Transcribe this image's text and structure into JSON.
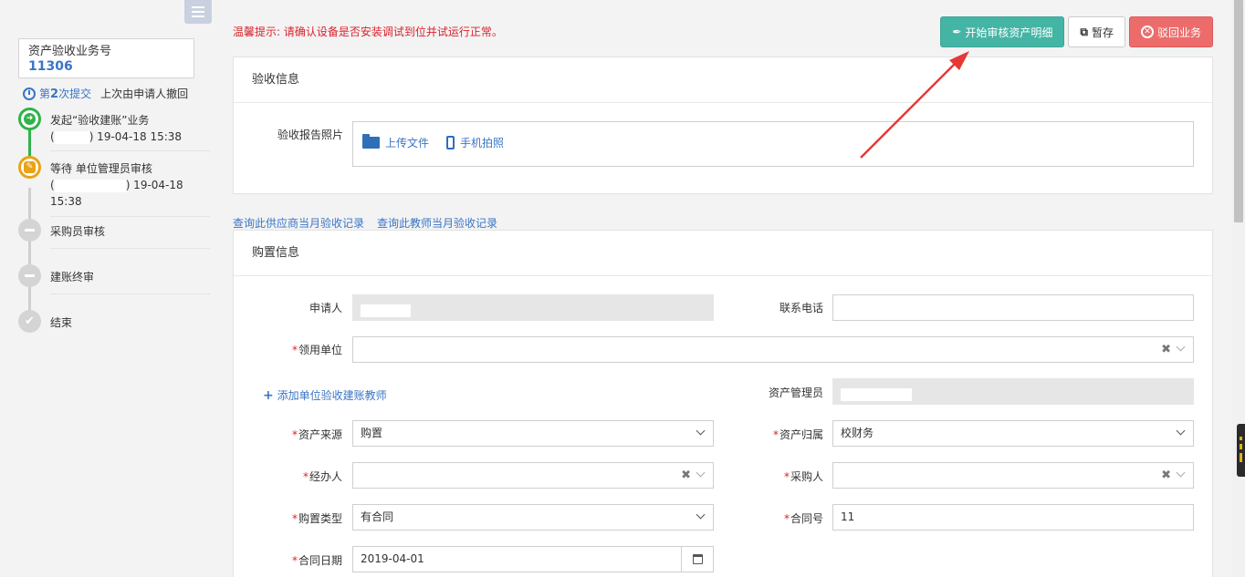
{
  "sidebar": {
    "biz_label": "资产验收业务号",
    "biz_number": "11306",
    "submit_prefix": "第",
    "submit_count": "2",
    "submit_suffix": "次提交",
    "submit_note": "上次由申请人撤回",
    "steps": [
      {
        "line1": "发起“验收建账”业务",
        "line2_prefix": "(",
        "line2_suffix": ") 19-04-18 15:38"
      },
      {
        "line1": "等待 单位管理员审核",
        "line2_prefix": "(",
        "line2_suffix": ") 19-04-18",
        "line3": "15:38"
      },
      {
        "line1": "采购员审核"
      },
      {
        "line1": "建账终审"
      },
      {
        "line1": "结束"
      }
    ]
  },
  "header": {
    "tip": "温馨提示: 请确认设备是否安装调试到位并试运行正常。",
    "btn_start_review": "开始审核资产明细",
    "btn_save": "暂存",
    "btn_withdraw": "驳回业务"
  },
  "acceptance": {
    "title": "验收信息",
    "photo_label": "验收报告照片",
    "upload_file": "上传文件",
    "phone_photo": "手机拍照"
  },
  "links": {
    "supplier_records": "查询此供应商当月验收记录",
    "teacher_records": "查询此教师当月验收记录"
  },
  "purchase": {
    "title": "购置信息",
    "applicant_label": "申请人",
    "phone_label": "联系电话",
    "unit_label": "领用单位",
    "add_teacher": "添加单位验收建账教师",
    "asset_manager_label": "资产管理员",
    "source_label": "资产来源",
    "source_value": "购置",
    "ownership_label": "资产归属",
    "ownership_value": "校财务",
    "handler_label": "经办人",
    "buyer_label": "采购人",
    "purchase_type_label": "购置类型",
    "purchase_type_value": "有合同",
    "contract_no_label": "合同号",
    "contract_no_value": "11",
    "contract_date_label": "合同日期",
    "contract_date_value": "2019-04-01"
  },
  "colors": {
    "primary": "#44b5a5",
    "danger": "#ec6c6c",
    "link": "#3a75c4",
    "warning_text": "#d9232a",
    "step_done": "#2fb34a",
    "step_current": "#e8a317"
  }
}
